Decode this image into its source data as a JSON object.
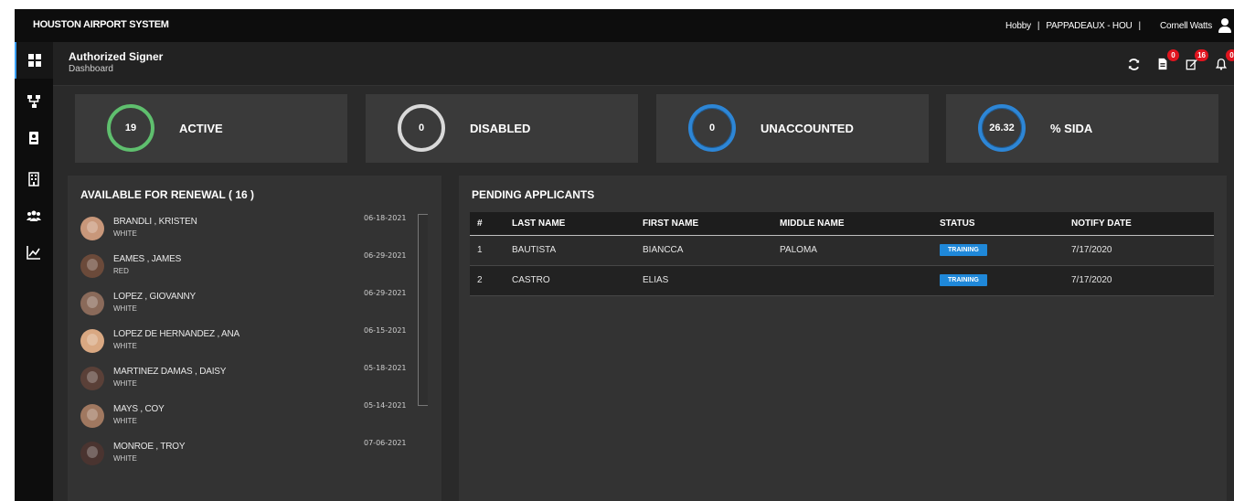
{
  "app": {
    "brand": "HOUSTON AIRPORT SYSTEM",
    "top_links": {
      "hobby": "Hobby",
      "company": "PAPPADEAUX - HOU",
      "user": "Cornell Watts",
      "separator": "|"
    }
  },
  "header": {
    "title": "Authorized Signer",
    "breadcrumb": "Dashboard"
  },
  "sidebar": {
    "items": [
      {
        "icon": "dashboard-grid-icon",
        "active": true
      },
      {
        "icon": "org-chart-icon"
      },
      {
        "icon": "badge-icon"
      },
      {
        "icon": "building-icon"
      },
      {
        "icon": "users-icon"
      },
      {
        "icon": "chart-line-icon"
      }
    ]
  },
  "header_icons": [
    {
      "icon": "refresh-icon"
    },
    {
      "icon": "document-icon",
      "count": "0"
    },
    {
      "icon": "edit-icon",
      "count": "16"
    },
    {
      "icon": "bell-icon",
      "count": "0"
    }
  ],
  "stats": [
    {
      "value": "19",
      "label": "ACTIVE",
      "color": "#5fbf6e"
    },
    {
      "value": "0",
      "label": "DISABLED",
      "color": "#d9d9d9"
    },
    {
      "value": "0",
      "label": "UNACCOUNTED",
      "color": "#2d86d6"
    },
    {
      "value": "26.32",
      "label": "% SIDA",
      "color": "#2d86d6"
    }
  ],
  "renewal": {
    "title": "AVAILABLE FOR RENEWAL ( 16 )",
    "items": [
      {
        "name": "BRANDLI , KRISTEN",
        "badge_color": "WHITE",
        "date": "06-18-2021"
      },
      {
        "name": "EAMES , JAMES",
        "badge_color": "RED",
        "date": "06-29-2021"
      },
      {
        "name": "LOPEZ , GIOVANNY",
        "badge_color": "WHITE",
        "date": "06-29-2021"
      },
      {
        "name": "LOPEZ DE HERNANDEZ , ANA",
        "badge_color": "WHITE",
        "date": "06-15-2021"
      },
      {
        "name": "MARTINEZ DAMAS , DAISY",
        "badge_color": "WHITE",
        "date": "05-18-2021"
      },
      {
        "name": "MAYS , COY",
        "badge_color": "WHITE",
        "date": "05-14-2021"
      },
      {
        "name": "MONROE , TROY",
        "badge_color": "WHITE",
        "date": "07-06-2021"
      }
    ]
  },
  "pending": {
    "title": "PENDING APPLICANTS",
    "columns": [
      "#",
      "LAST NAME",
      "FIRST NAME",
      "MIDDLE NAME",
      "STATUS",
      "NOTIFY DATE"
    ],
    "rows": [
      {
        "num": "1",
        "last": "BAUTISTA",
        "first": "BIANCCA",
        "middle": "PALOMA",
        "status": "TRAINING",
        "date": "7/17/2020"
      },
      {
        "num": "2",
        "last": "CASTRO",
        "first": "ELIAS",
        "middle": "",
        "status": "TRAINING",
        "date": "7/17/2020"
      }
    ]
  },
  "colors": {
    "accent": "#2d86d6",
    "badge_red": "#e0141e",
    "status_blue": "#1f88d9"
  }
}
